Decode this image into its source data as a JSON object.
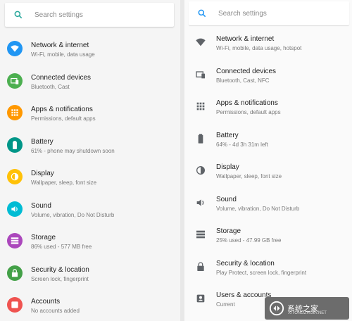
{
  "left": {
    "search_placeholder": "Search settings",
    "items": [
      {
        "title": "Network & internet",
        "subtitle": "Wi-Fi, mobile, data usage",
        "icon": "wifi-icon",
        "color": "#2196f3"
      },
      {
        "title": "Connected devices",
        "subtitle": "Bluetooth, Cast",
        "icon": "devices-icon",
        "color": "#4caf50"
      },
      {
        "title": "Apps & notifications",
        "subtitle": "Permissions, default apps",
        "icon": "apps-icon",
        "color": "#ff9800"
      },
      {
        "title": "Battery",
        "subtitle": "61% - phone may shutdown soon",
        "icon": "battery-icon",
        "color": "#009688"
      },
      {
        "title": "Display",
        "subtitle": "Wallpaper, sleep, font size",
        "icon": "display-icon",
        "color": "#ffc107"
      },
      {
        "title": "Sound",
        "subtitle": "Volume, vibration, Do Not Disturb",
        "icon": "sound-icon",
        "color": "#00bcd4"
      },
      {
        "title": "Storage",
        "subtitle": "86% used - 577 MB free",
        "icon": "storage-icon",
        "color": "#ab47bc"
      },
      {
        "title": "Security & location",
        "subtitle": "Screen lock, fingerprint",
        "icon": "lock-icon",
        "color": "#43a047"
      },
      {
        "title": "Accounts",
        "subtitle": "No accounts added",
        "icon": "account-icon",
        "color": "#ef5350"
      }
    ]
  },
  "right": {
    "search_placeholder": "Search settings",
    "items": [
      {
        "title": "Network & internet",
        "subtitle": "Wi-Fi, mobile, data usage, hotspot",
        "icon": "wifi-icon"
      },
      {
        "title": "Connected devices",
        "subtitle": "Bluetooth, Cast, NFC",
        "icon": "devices-icon"
      },
      {
        "title": "Apps & notifications",
        "subtitle": "Permissions, default apps",
        "icon": "apps-icon"
      },
      {
        "title": "Battery",
        "subtitle": "64% - 4d 3h 31m left",
        "icon": "battery-icon"
      },
      {
        "title": "Display",
        "subtitle": "Wallpaper, sleep, font size",
        "icon": "display-icon"
      },
      {
        "title": "Sound",
        "subtitle": "Volume, vibration, Do Not Disturb",
        "icon": "sound-icon"
      },
      {
        "title": "Storage",
        "subtitle": "25% used - 47.99 GB free",
        "icon": "storage-icon"
      },
      {
        "title": "Security & location",
        "subtitle": "Play Protect, screen lock, fingerprint",
        "icon": "lock-icon"
      },
      {
        "title": "Users & accounts",
        "subtitle": "Current",
        "icon": "account-icon"
      }
    ]
  },
  "watermark": {
    "text": "系统之家",
    "url": "XITONGZHIJIA.NET"
  },
  "colors": {
    "search_icon_left": "#26a69a",
    "search_icon_right": "#2196f3",
    "right_icon": "#5f6368"
  }
}
